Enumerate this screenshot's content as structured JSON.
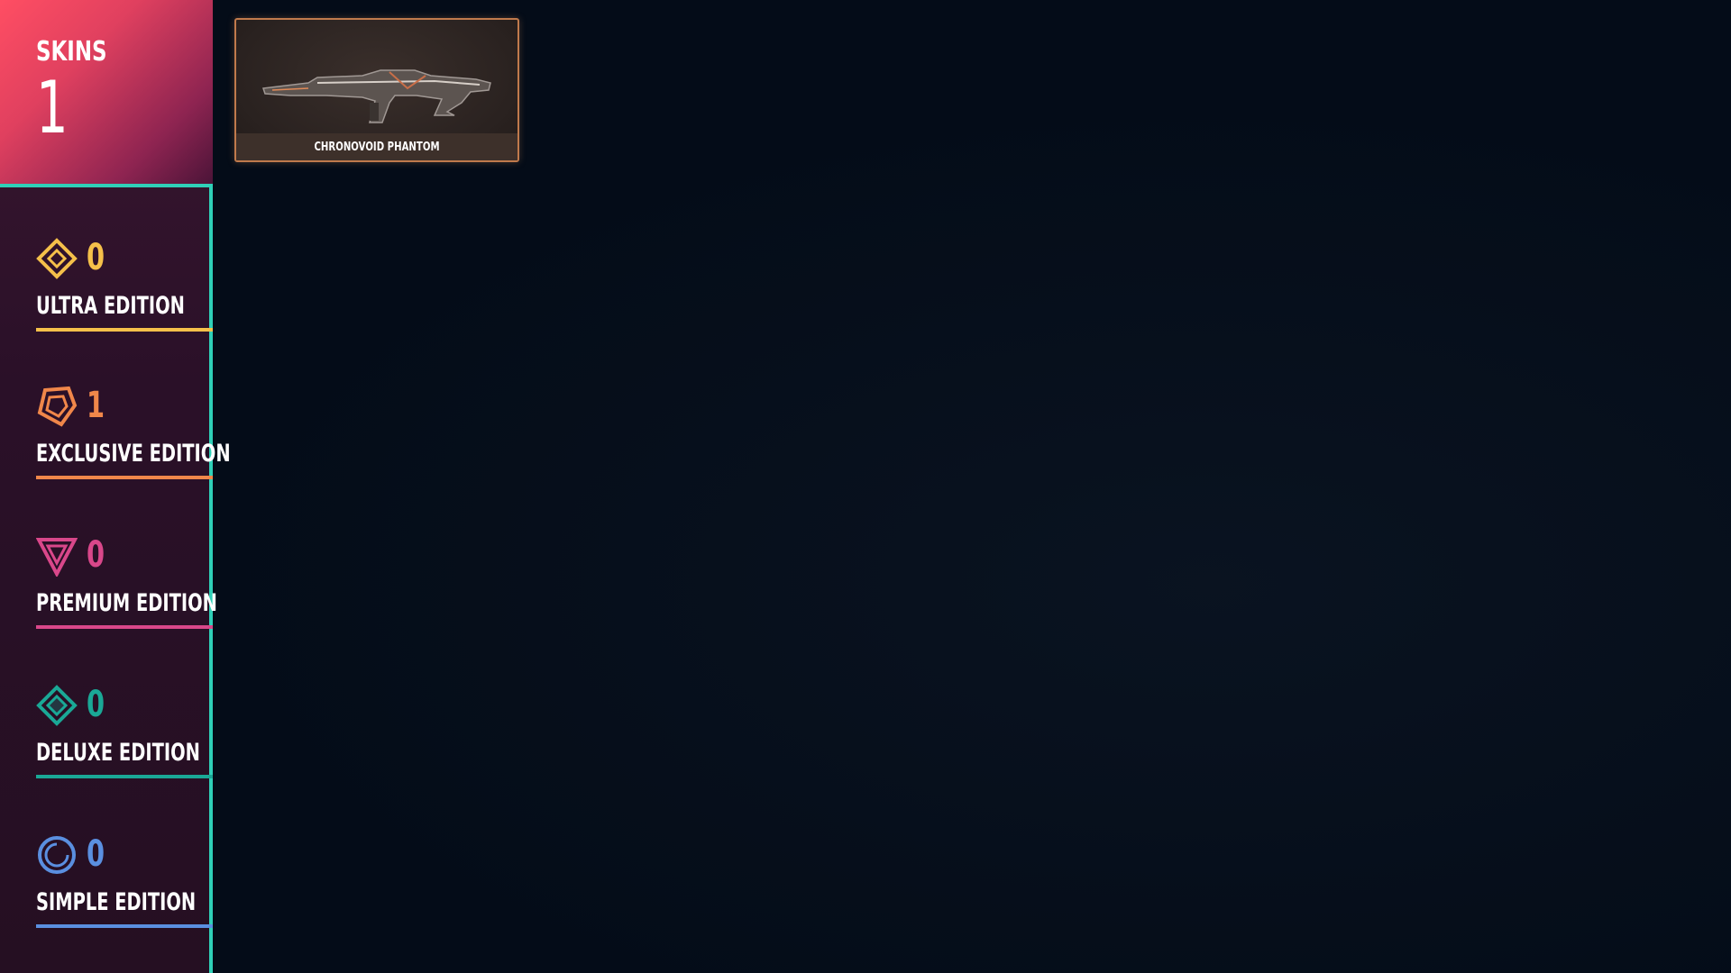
{
  "summary": {
    "label": "SKINS",
    "count": "1"
  },
  "editions": [
    {
      "name": "ULTRA EDITION",
      "count": "0",
      "color": "#f5c04a",
      "icon": "ultra-diamond-icon"
    },
    {
      "name": "EXCLUSIVE EDITION",
      "count": "1",
      "color": "#f0874a",
      "icon": "exclusive-pentagon-icon"
    },
    {
      "name": "PREMIUM EDITION",
      "count": "0",
      "color": "#d9478a",
      "icon": "premium-triangle-icon"
    },
    {
      "name": "DELUXE EDITION",
      "count": "0",
      "color": "#1aa896",
      "icon": "deluxe-diamond-icon"
    },
    {
      "name": "SIMPLE EDITION",
      "count": "0",
      "color": "#5a8fe0",
      "icon": "simple-circle-icon"
    }
  ],
  "skins": [
    {
      "name": "CHRONOVOID PHANTOM",
      "edition": "EXCLUSIVE EDITION",
      "icon": "rifle-icon"
    }
  ],
  "colors": {
    "accent": "#2fd0b8",
    "header_gradient_start": "#ff4e63",
    "card_border": "#c07a4c"
  }
}
